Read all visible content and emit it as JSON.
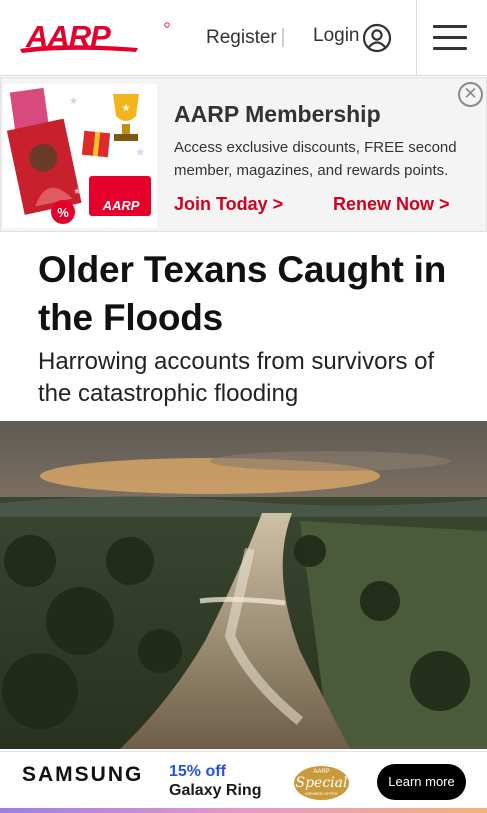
{
  "header": {
    "logo_text": "AARP",
    "register_label": "Register",
    "login_label": "Login",
    "brand_color": "#e4002b"
  },
  "promo": {
    "title": "AARP Membership",
    "description": "Access exclusive discounts, FREE second member, magazines, and rewards points.",
    "join_label": "Join Today >",
    "renew_label": "Renew Now >",
    "close_glyph": "✕",
    "art": {
      "card_text": "AARP",
      "discount_badge": "%"
    }
  },
  "article": {
    "headline": "Older Texans Caught in the Floods",
    "dek": "Harrowing accounts from survivors of the catastrophic flooding"
  },
  "ad": {
    "brand": "SAMSUNG",
    "offer_percent": "15% off",
    "offer_product": "Galaxy Ring",
    "seal_top": "AARP",
    "seal_main": "Special",
    "seal_bottom": "MEMBER OFFER",
    "cta_label": "Learn more"
  },
  "icons": {
    "login": "user-circle-icon",
    "menu": "hamburger-menu-icon",
    "close": "close-icon"
  }
}
